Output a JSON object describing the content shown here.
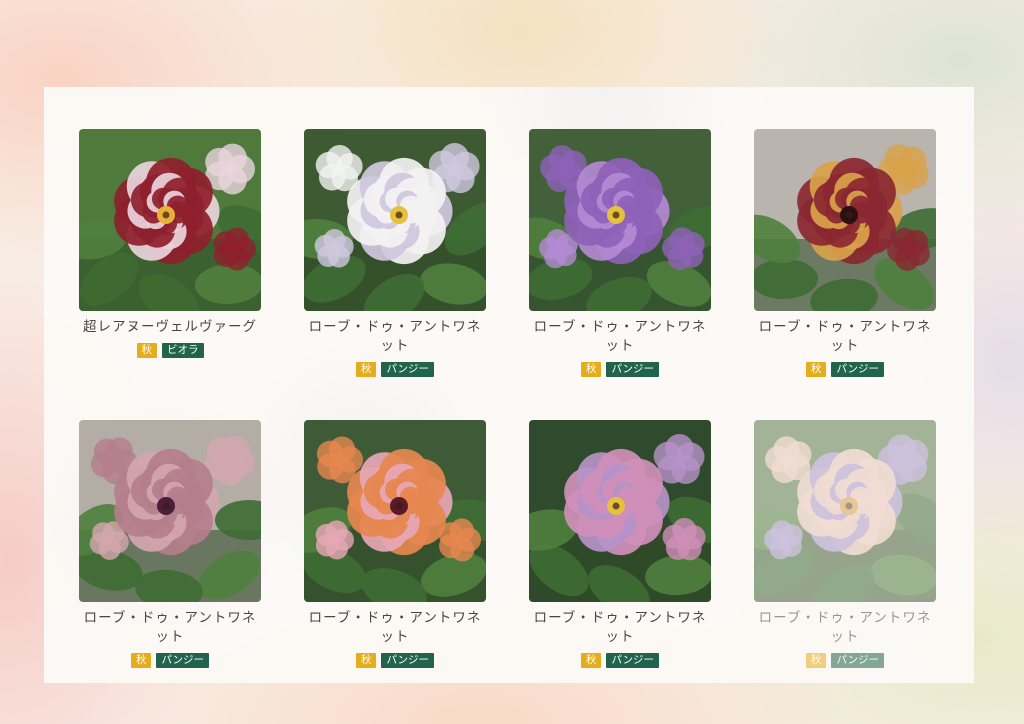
{
  "products": [
    {
      "name": "超レアヌーヴェルヴァーグ",
      "season": "秋",
      "type": "ビオラ",
      "image": "viola-red-white-photo",
      "palette": {
        "petal": "#8e1f2c",
        "accent": "#e9d4dc",
        "center": "#e8b23a",
        "bg": "#4f7a3c"
      }
    },
    {
      "name": "ローブ・ドゥ・アントワネット",
      "season": "秋",
      "type": "パンジー",
      "image": "white-ruffled-pansy-photo",
      "palette": {
        "petal": "#f3f2f3",
        "accent": "#cfc8de",
        "center": "#e6c23c",
        "bg": "#3d5a33"
      }
    },
    {
      "name": "ローブ・ドゥ・アントワネット",
      "season": "秋",
      "type": "パンジー",
      "image": "purple-ruffled-pansy-photo",
      "palette": {
        "petal": "#8e62b8",
        "accent": "#b48ad4",
        "center": "#e6c23c",
        "bg": "#42613a"
      }
    },
    {
      "name": "ローブ・ドゥ・アントワネット",
      "season": "秋",
      "type": "パンジー",
      "image": "burgundy-gold-pansy-photo",
      "palette": {
        "petal": "#8a2731",
        "accent": "#d9a24a",
        "center": "#2a1012",
        "bg": "#b9b4ad"
      }
    },
    {
      "name": "ローブ・ドゥ・アントワネット",
      "season": "秋",
      "type": "パンジー",
      "image": "mauve-pink-pansy-photo",
      "palette": {
        "petal": "#b57e8c",
        "accent": "#d3a6ae",
        "center": "#4a1f3a",
        "bg": "#b3ada6"
      }
    },
    {
      "name": "ローブ・ドゥ・アントワネット",
      "season": "秋",
      "type": "パンジー",
      "image": "orange-pink-pansy-photo",
      "palette": {
        "petal": "#e6874f",
        "accent": "#e7a7b6",
        "center": "#5a1a2a",
        "bg": "#3f5a36"
      }
    },
    {
      "name": "ローブ・ドゥ・アントワネット",
      "season": "秋",
      "type": "パンジー",
      "image": "pink-lavender-pansy-photo",
      "palette": {
        "petal": "#cf8fb9",
        "accent": "#b692c8",
        "center": "#e6c23c",
        "bg": "#2f4a2c"
      }
    },
    {
      "name": "ローブ・ドゥ・アントワネット",
      "season": "秋",
      "type": "パンジー",
      "image": "peach-lavender-pansy-photo",
      "palette": {
        "petal": "#e7c6b6",
        "accent": "#a895c9",
        "center": "#d9a04a",
        "bg": "#5b7a4a"
      }
    }
  ]
}
